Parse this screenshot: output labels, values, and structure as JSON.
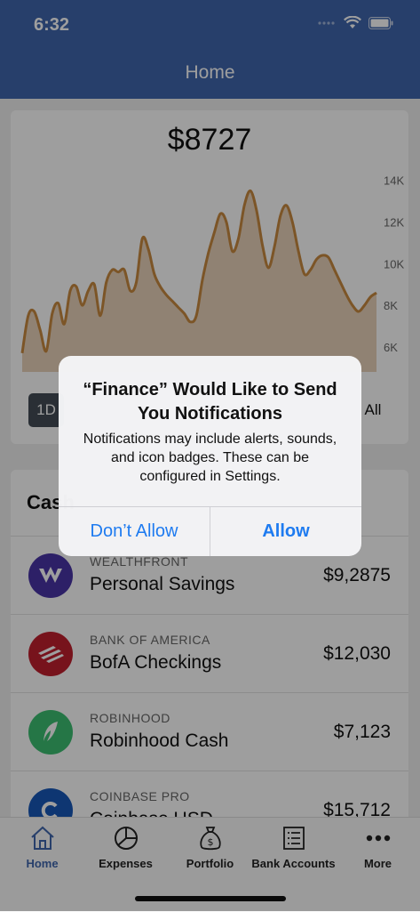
{
  "status_bar": {
    "time": "6:32"
  },
  "nav": {
    "title": "Home"
  },
  "chart": {
    "balance": "$8727",
    "y_ticks": [
      "14K",
      "12K",
      "10K",
      "8K",
      "6K"
    ],
    "range_selected": "1D",
    "range_all": "All",
    "line_color": "#c98a3f"
  },
  "chart_data": {
    "type": "area",
    "title": "$8727",
    "xlabel": "",
    "ylabel": "",
    "ylim": [
      4800,
      14800
    ],
    "y_ticks": [
      "14K",
      "12K",
      "10K",
      "8K",
      "6K"
    ],
    "x": [
      0,
      1,
      2,
      3,
      4,
      5,
      6,
      7,
      8,
      9,
      10,
      11,
      12,
      13,
      14,
      15,
      16,
      17,
      18,
      19,
      20,
      21,
      22,
      23,
      24,
      25,
      26,
      27,
      28,
      29,
      30,
      31,
      32,
      33,
      34,
      35,
      36,
      37,
      38,
      39,
      40,
      41,
      42,
      43,
      44,
      45,
      46,
      47,
      48,
      49,
      50,
      51,
      52,
      53,
      54,
      55,
      56,
      57,
      58,
      59
    ],
    "values": [
      5700,
      7500,
      7700,
      6800,
      5800,
      7600,
      8100,
      7100,
      8700,
      8900,
      8000,
      8700,
      9000,
      7500,
      9100,
      9700,
      9600,
      9700,
      8700,
      9100,
      11200,
      10700,
      9500,
      8900,
      8500,
      8200,
      7900,
      7600,
      7200,
      7500,
      9200,
      10500,
      11500,
      12400,
      12000,
      10600,
      11200,
      12800,
      13500,
      12600,
      10900,
      9800,
      10800,
      12300,
      12800,
      12000,
      10600,
      9500,
      9700,
      10200,
      10400,
      10300,
      9700,
      9100,
      8500,
      8000,
      7700,
      8000,
      8400,
      8600
    ],
    "grid": false,
    "line_color": "#c98a3f",
    "fill_color": "#e0c3a3"
  },
  "accounts": {
    "title": "Cash",
    "items": [
      {
        "institution": "WEALTHFRONT",
        "name": "Personal Savings",
        "amount": "$9,2875",
        "color": "#4935a6",
        "icon": "wealthfront-logo-icon"
      },
      {
        "institution": "BANK OF AMERICA",
        "name": "BofA Checkings",
        "amount": "$12,030",
        "color": "#c0202e",
        "icon": "bank-of-america-logo-icon"
      },
      {
        "institution": "ROBINHOOD",
        "name": "Robinhood Cash",
        "amount": "$7,123",
        "color": "#3cbf72",
        "icon": "robinhood-feather-icon"
      },
      {
        "institution": "COINBASE PRO",
        "name": "Coinbase USD",
        "amount": "$15,712",
        "color": "#1757b8",
        "icon": "coinbase-logo-icon"
      }
    ]
  },
  "tabs": [
    {
      "label": "Home",
      "icon": "home-icon",
      "active": true
    },
    {
      "label": "Expenses",
      "icon": "pie-chart-icon",
      "active": false
    },
    {
      "label": "Portfolio",
      "icon": "money-bag-icon",
      "active": false
    },
    {
      "label": "Bank Accounts",
      "icon": "ledger-icon",
      "active": false
    },
    {
      "label": "More",
      "icon": "more-dots-icon",
      "active": false
    }
  ],
  "alert": {
    "title": "“Finance” Would Like to Send You Notifications",
    "message": "Notifications may include alerts, sounds, and icon badges. These can be configured in Settings.",
    "deny_label": "Don’t Allow",
    "allow_label": "Allow"
  },
  "colors": {
    "nav_blue": "#3f66ad",
    "accent_blue": "#1e7bf0"
  }
}
